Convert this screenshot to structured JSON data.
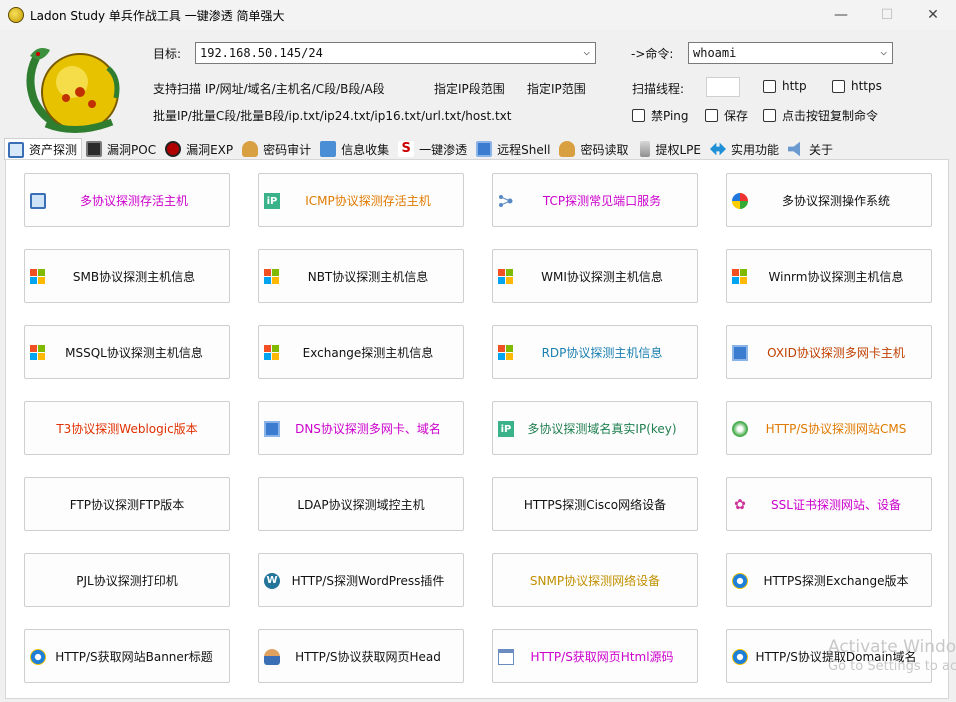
{
  "window": {
    "title": "Ladon Study 单兵作战工具 一键渗透 简单强大",
    "min_glyph": "—",
    "max_glyph": "☐",
    "close_glyph": "✕"
  },
  "target": {
    "label": "目标:",
    "value": "192.168.50.145/24"
  },
  "command": {
    "label": "->命令:",
    "value": "whoami"
  },
  "support": {
    "scan_text": "支持扫描 IP/网址/域名/主机名/C段/B段/A段",
    "ip_range": "指定IP段范围",
    "ip_range2": "指定IP范围",
    "batch_text": "批量IP/批量C段/批量B段/ip.txt/ip24.txt/ip16.txt/url.txt/host.txt"
  },
  "threads": {
    "label": "扫描线程:",
    "value": ""
  },
  "options": {
    "http": "http",
    "https": "https",
    "noping": "禁Ping",
    "save": "保存",
    "copy_cmd": "点击按钮复制命令"
  },
  "tabs": [
    {
      "label": "资产探测",
      "icon": "monitor-icon"
    },
    {
      "label": "漏洞POC",
      "icon": "bug-icon"
    },
    {
      "label": "漏洞EXP",
      "icon": "exploit-icon"
    },
    {
      "label": "密码审计",
      "icon": "users-icon"
    },
    {
      "label": "信息收集",
      "icon": "network-icon"
    },
    {
      "label": "一键渗透",
      "icon": "s-icon"
    },
    {
      "label": "远程Shell",
      "icon": "shell-icon"
    },
    {
      "label": "密码读取",
      "icon": "key-icon"
    },
    {
      "label": "提权LPE",
      "icon": "tower-icon"
    },
    {
      "label": "实用功能",
      "icon": "arrows-icon"
    },
    {
      "label": "关于",
      "icon": "speaker-icon"
    }
  ],
  "buttons": [
    {
      "label": "多协议探测存活主机",
      "color": "#cc00cc",
      "icon": "computer-icon"
    },
    {
      "label": "ICMP协议探测存活主机",
      "color": "#e07a00",
      "icon": "ip-icon"
    },
    {
      "label": "TCP探测常见端口服务",
      "color": "#cc00cc",
      "icon": "ports-icon"
    },
    {
      "label": "多协议探测操作系统",
      "color": "#111111",
      "icon": "windows-orb-icon"
    },
    {
      "label": "SMB协议探测主机信息",
      "color": "#111111",
      "icon": "windows-flag-icon"
    },
    {
      "label": "NBT协议探测主机信息",
      "color": "#111111",
      "icon": "windows-flag-icon"
    },
    {
      "label": "WMI协议探测主机信息",
      "color": "#111111",
      "icon": "windows-flag-icon"
    },
    {
      "label": "Winrm协议探测主机信息",
      "color": "#111111",
      "icon": "windows-flag-icon"
    },
    {
      "label": "MSSQL协议探测主机信息",
      "color": "#111111",
      "icon": "windows-flag-icon"
    },
    {
      "label": "Exchange探测主机信息",
      "color": "#111111",
      "icon": "windows-flag-icon"
    },
    {
      "label": "RDP协议探测主机信息",
      "color": "#1a7fb0",
      "icon": "windows-flag-icon"
    },
    {
      "label": "OXID协议探测多网卡主机",
      "color": "#c04000",
      "icon": "network-card-icon"
    },
    {
      "label": "T3协议探测Weblogic版本",
      "color": "#e03000",
      "icon": ""
    },
    {
      "label": "DNS协议探测多网卡、域名",
      "color": "#cc00cc",
      "icon": "network-card-icon"
    },
    {
      "label": "多协议探测域名真实IP(key)",
      "color": "#207f50",
      "icon": "ip-icon"
    },
    {
      "label": "HTTP/S协议探测网站CMS",
      "color": "#e07a00",
      "icon": "green-orb-icon"
    },
    {
      "label": "FTP协议探测FTP版本",
      "color": "#111111",
      "icon": ""
    },
    {
      "label": "LDAP协议探测域控主机",
      "color": "#111111",
      "icon": ""
    },
    {
      "label": "HTTPS探测Cisco网络设备",
      "color": "#111111",
      "icon": ""
    },
    {
      "label": "SSL证书探测网站、设备",
      "color": "#cc00cc",
      "icon": "cert-icon"
    },
    {
      "label": "PJL协议探测打印机",
      "color": "#111111",
      "icon": ""
    },
    {
      "label": "HTTP/S探测WordPress插件",
      "color": "#111111",
      "icon": "wordpress-icon"
    },
    {
      "label": "SNMP协议探测网络设备",
      "color": "#c09000",
      "icon": ""
    },
    {
      "label": "HTTPS探测Exchange版本",
      "color": "#111111",
      "icon": "ie-icon"
    },
    {
      "label": "HTTP/S获取网站Banner标题",
      "color": "#111111",
      "icon": "ie-icon"
    },
    {
      "label": "HTTP/S协议获取网页Head",
      "color": "#111111",
      "icon": "user-icon"
    },
    {
      "label": "HTTP/S获取网页Html源码",
      "color": "#cc00cc",
      "icon": "webpage-icon"
    },
    {
      "label": "HTTP/S协议提取Domain域名",
      "color": "#111111",
      "icon": "ie-icon"
    }
  ],
  "watermark": {
    "line1": "Activate Windo",
    "line2": "Go to Settings to ac"
  }
}
